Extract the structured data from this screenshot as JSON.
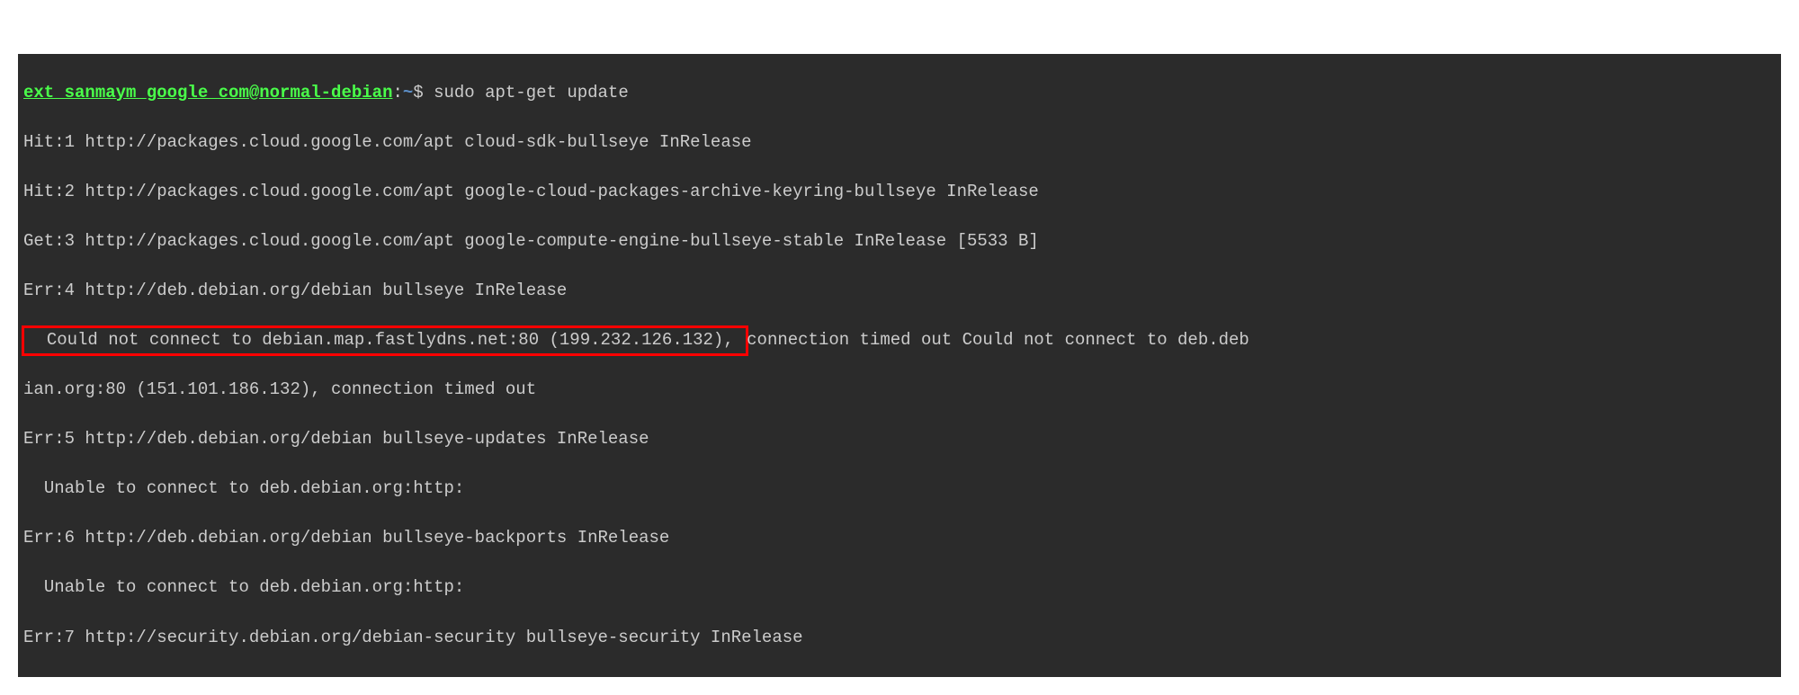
{
  "prompt": {
    "user_host": "ext_sanmaym_google_com@normal-debian",
    "colon": ":",
    "path": "~",
    "dollar": "$",
    "command": "sudo apt-get update"
  },
  "lines": {
    "l1": "Hit:1 http://packages.cloud.google.com/apt cloud-sdk-bullseye InRelease",
    "l2": "Hit:2 http://packages.cloud.google.com/apt google-cloud-packages-archive-keyring-bullseye InRelease",
    "l3": "Get:3 http://packages.cloud.google.com/apt google-compute-engine-bullseye-stable InRelease [5533 B]",
    "l4": "Err:4 http://deb.debian.org/debian bullseye InRelease",
    "l5a": "  Could not connect to debian.map.fastlydns.net:80 (199.232.126.132), ",
    "l5b": "connection timed out Could not connect to deb.deb",
    "l5c": "ian.org:80 (151.101.186.132), connection timed out",
    "l6": "Err:5 http://deb.debian.org/debian bullseye-updates InRelease",
    "l7": "  Unable to connect to deb.debian.org:http:",
    "l8": "Err:6 http://deb.debian.org/debian bullseye-backports InRelease",
    "l9": "  Unable to connect to deb.debian.org:http:",
    "l10": "Err:7 http://security.debian.org/debian-security bullseye-security InRelease"
  }
}
